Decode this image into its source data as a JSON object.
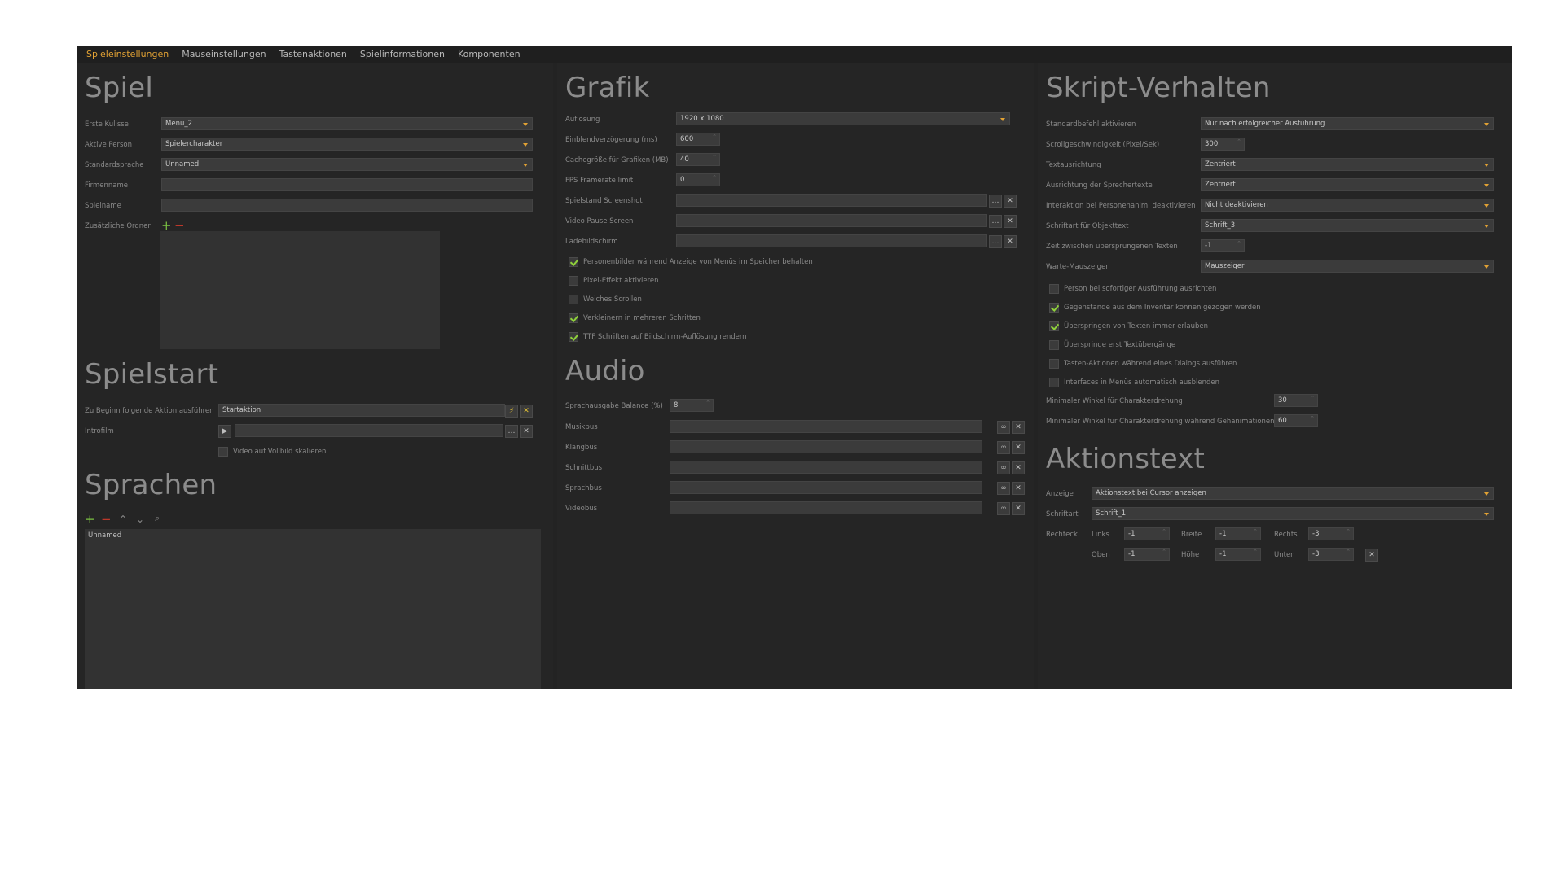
{
  "tabs": [
    "Spieleinstellungen",
    "Mauseinstellungen",
    "Tastenaktionen",
    "Spielinformationen",
    "Komponenten"
  ],
  "colors": {
    "accent": "#e2a234",
    "check": "#8fd13b",
    "add": "#7bc142",
    "remove": "#c0392b"
  },
  "spiel": {
    "title": "Spiel",
    "erste_kulisse_label": "Erste Kulisse",
    "erste_kulisse_value": "Menu_2",
    "aktive_person_label": "Aktive Person",
    "aktive_person_value": "Spielercharakter",
    "standardsprache_label": "Standardsprache",
    "standardsprache_value": "Unnamed",
    "firmenname_label": "Firmenname",
    "firmenname_value": "",
    "spielname_label": "Spielname",
    "spielname_value": "",
    "zusatz_ordner_label": "Zusätzliche Ordner"
  },
  "spielstart": {
    "title": "Spielstart",
    "beginn_label": "Zu Beginn folgende Aktion ausführen",
    "beginn_value": "Startaktion",
    "intro_label": "Introfilm",
    "intro_value": "",
    "vollbild_label": "Video auf Vollbild skalieren"
  },
  "sprachen": {
    "title": "Sprachen",
    "items": [
      "Unnamed"
    ]
  },
  "grafik": {
    "title": "Grafik",
    "aufloesung_label": "Auflösung",
    "aufloesung_value": "1920 x 1080",
    "einblend_label": "Einblendverzögerung (ms)",
    "einblend_value": "600",
    "cache_label": "Cachegröße für Grafiken (MB)",
    "cache_value": "40",
    "fps_label": "FPS Framerate limit",
    "fps_value": "0",
    "screenshot_label": "Spielstand Screenshot",
    "pause_label": "Video Pause Screen",
    "lade_label": "Ladebildschirm",
    "checks": [
      {
        "label": "Personenbilder während Anzeige von Menüs im Speicher behalten",
        "on": true
      },
      {
        "label": "Pixel-Effekt aktivieren",
        "on": false
      },
      {
        "label": "Weiches Scrollen",
        "on": false
      },
      {
        "label": "Verkleinern in mehreren Schritten",
        "on": true
      },
      {
        "label": "TTF Schriften auf Bildschirm-Auflösung rendern",
        "on": true
      }
    ]
  },
  "audio": {
    "title": "Audio",
    "balance_label": "Sprachausgabe Balance (%)",
    "balance_value": "8",
    "busses": [
      "Musikbus",
      "Klangbus",
      "Schnittbus",
      "Sprachbus",
      "Videobus"
    ]
  },
  "skript": {
    "title": "Skript-Verhalten",
    "standardbefehl_label": "Standardbefehl aktivieren",
    "standardbefehl_value": "Nur nach erfolgreicher Ausführung",
    "scroll_label": "Scrollgeschwindigkeit (Pixel/Sek)",
    "scroll_value": "300",
    "textausrichtung_label": "Textausrichtung",
    "textausrichtung_value": "Zentriert",
    "sprechertexte_label": "Ausrichtung der Sprechertexte",
    "sprechertexte_value": "Zentriert",
    "interaktion_label": "Interaktion bei Personenanim. deaktivieren",
    "interaktion_value": "Nicht deaktivieren",
    "schriftart_label": "Schriftart für Objekttext",
    "schriftart_value": "Schrift_3",
    "zeit_label": "Zeit zwischen übersprungenen Texten",
    "zeit_value": "-1",
    "warte_label": "Warte-Mauszeiger",
    "warte_value": "Mauszeiger",
    "checks": [
      {
        "label": "Person bei sofortiger Ausführung ausrichten",
        "on": false
      },
      {
        "label": "Gegenstände aus dem Inventar können gezogen werden",
        "on": true
      },
      {
        "label": "Überspringen von Texten immer erlauben",
        "on": true
      },
      {
        "label": "Überspringe erst Textübergänge",
        "on": false
      },
      {
        "label": "Tasten-Aktionen während eines Dialogs ausführen",
        "on": false
      },
      {
        "label": "Interfaces in Menüs automatisch ausblenden",
        "on": false
      }
    ],
    "min_winkel_label": "Minimaler Winkel für Charakterdrehung",
    "min_winkel_value": "30",
    "min_winkel_geh_label": "Minimaler Winkel für Charakterdrehung während Gehanimationen",
    "min_winkel_geh_value": "60"
  },
  "aktionstext": {
    "title": "Aktionstext",
    "anzeige_label": "Anzeige",
    "anzeige_value": "Aktionstext bei Cursor anzeigen",
    "schriftart_label": "Schriftart",
    "schriftart_value": "Schrift_1",
    "rechteck_label": "Rechteck",
    "links_label": "Links",
    "links_value": "-1",
    "breite_label": "Breite",
    "breite_value": "-1",
    "rechts_label": "Rechts",
    "rechts_value": "-3",
    "oben_label": "Oben",
    "oben_value": "-1",
    "hoehe_label": "Höhe",
    "hoehe_value": "-1",
    "unten_label": "Unten",
    "unten_value": "-3"
  }
}
